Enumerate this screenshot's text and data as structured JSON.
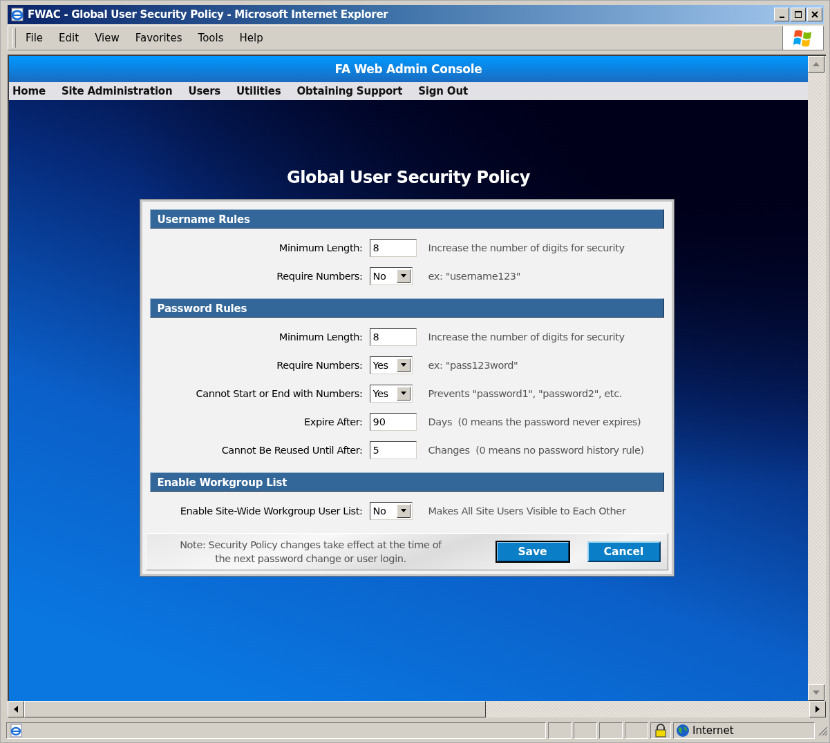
{
  "window": {
    "title": "FWAC - Global User Security Policy - Microsoft Internet Explorer"
  },
  "menu": [
    "File",
    "Edit",
    "View",
    "Favorites",
    "Tools",
    "Help"
  ],
  "console": {
    "title": "FA Web Admin Console",
    "nav": [
      "Home",
      "Site Administration",
      "Users",
      "Utilities",
      "Obtaining Support",
      "Sign Out"
    ]
  },
  "heading": "Global User Security Policy",
  "sections": [
    {
      "title": "Username Rules",
      "rows": [
        {
          "kind": "text",
          "label": "Minimum Length:",
          "value": "8",
          "hint": "Increase the number of digits for security"
        },
        {
          "kind": "select",
          "label": "Require Numbers:",
          "value": "No",
          "hint": "ex: \"username123\""
        }
      ]
    },
    {
      "title": "Password Rules",
      "rows": [
        {
          "kind": "text",
          "label": "Minimum Length:",
          "value": "8",
          "hint": "Increase the number of digits for security"
        },
        {
          "kind": "select",
          "label": "Require Numbers:",
          "value": "Yes",
          "hint": "ex: \"pass123word\""
        },
        {
          "kind": "select",
          "label": "Cannot Start or End with Numbers:",
          "value": "Yes",
          "hint": "Prevents \"password1\", \"password2\", etc."
        },
        {
          "kind": "text",
          "label": "Expire After:",
          "value": "90",
          "hint": "Days  (0 means the password never expires)"
        },
        {
          "kind": "text",
          "label": "Cannot Be Reused Until After:",
          "value": "5",
          "hint": "Changes  (0 means no password history rule)"
        }
      ]
    },
    {
      "title": "Enable Workgroup List",
      "rows": [
        {
          "kind": "select",
          "label": "Enable Site-Wide Workgroup User List:",
          "value": "No",
          "hint": "Makes All Site Users Visible to Each Other"
        }
      ]
    }
  ],
  "note": "Note: Security Policy changes take effect at the time of the next password change or user login.",
  "buttons": [
    {
      "label": "Save",
      "default": true
    },
    {
      "label": "Cancel",
      "default": false
    }
  ],
  "status_bar": {
    "zone": "Internet"
  }
}
